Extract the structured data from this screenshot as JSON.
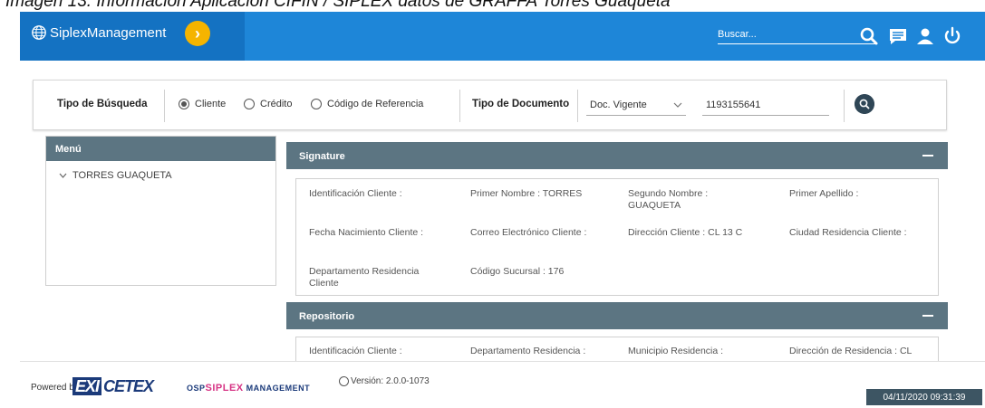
{
  "caption": "Imagen 13. Información Aplicación CIFIN / SIPLEX datos de GRAFFA Torres Guaqueta",
  "header": {
    "brand": "SiplexManagement",
    "search_placeholder": "Buscar...",
    "icons": [
      "globe-icon",
      "chevron-right-icon",
      "search-icon",
      "chat-icon",
      "user-icon",
      "power-icon"
    ],
    "brand_color": "#1e86d8",
    "accent_color": "#f5b400"
  },
  "search": {
    "tipo_busqueda_label": "Tipo de Búsqueda",
    "options": [
      "Cliente",
      "Crédito",
      "Código de Referencia"
    ],
    "selected": "Cliente",
    "tipo_documento_label": "Tipo de Documento",
    "doc_type": "Doc. Vigente",
    "doc_number": "1193155641"
  },
  "menu": {
    "title": "Menú",
    "item": "TORRES GUAQUETA"
  },
  "signature": {
    "title": "Signature",
    "fields": [
      "Identificación Cliente :",
      "Primer Nombre : TORRES",
      "Segundo Nombre : GUAQUETA",
      "Primer Apellido :",
      "Fecha Nacimiento Cliente :",
      "Correo Electrónico Cliente :",
      "Dirección Cliente : CL 13 C",
      "Ciudad Residencia Cliente :",
      "Departamento Residencia Cliente",
      "Código Sucursal : 176"
    ]
  },
  "repositorio": {
    "title": "Repositorio",
    "fields": [
      "Identificación Cliente :",
      "Departamento Residencia :",
      "Municipio Residencia :",
      "Dirección de Residencia : CL"
    ]
  },
  "footer": {
    "powered_by": "Powered by",
    "logo_cetex_box": "EXI",
    "logo_cetex": "CETEX",
    "logo_simplex_prefix": "OSP",
    "logo_simplex_main": "SIPLEX",
    "logo_simplex_suffix": "MANAGEMENT",
    "version": "Versión: 2.0.0-1073",
    "timestamp": "04/11/2020 09:31:39"
  }
}
